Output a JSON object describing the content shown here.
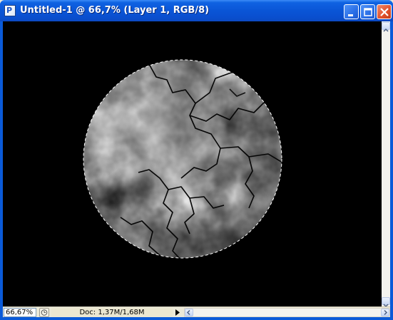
{
  "window": {
    "title": "Untitled-1 @ 66,7% (Layer 1, RGB/8)",
    "app_icon": "photoshop-document-icon",
    "buttons": [
      "minimize-icon",
      "maximize-icon",
      "close-icon"
    ]
  },
  "canvas": {
    "background": "#000000",
    "content": "circular-marble-selection",
    "selection": "marching-ants-circle"
  },
  "status": {
    "zoom": "66,67%",
    "doc_info": "Doc: 1,37M/1,68M"
  },
  "colors": {
    "titlebar": "#0a55d6",
    "close_button": "#e1502b",
    "statusbar": "#ece9d8"
  }
}
